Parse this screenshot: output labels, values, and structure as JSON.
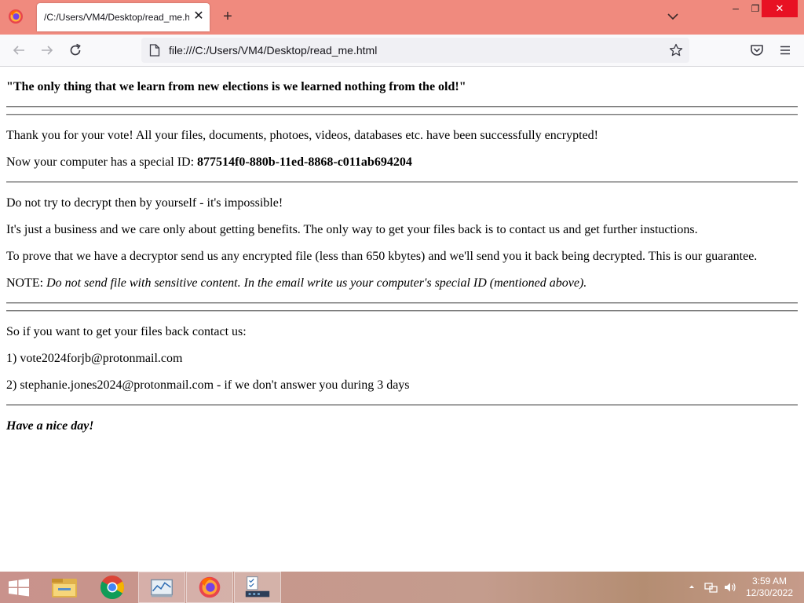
{
  "browser": {
    "tab_title": "/C:/Users/VM4/Desktop/read_me.html",
    "tab_close": "✕",
    "new_tab": "+",
    "url": "file:///C:/Users/VM4/Desktop/read_me.html",
    "window_controls": {
      "minimize": "–",
      "maximize": "❐",
      "close": "✕"
    },
    "accent": "#f08a7e"
  },
  "note": {
    "quote": "\"The only thing that we learn from new elections is we learned nothing from the old!\"",
    "thanks": "Thank you for your vote! All your files, documents, photoes, videos, databases etc. have been successfully encrypted!",
    "id_prefix": "Now your computer has a special ID: ",
    "id_value": "877514f0-880b-11ed-8868-c011ab694204",
    "warn": "Do not try to decrypt then by yourself - it's impossible!",
    "business": "It's just a business and we care only about getting benefits. The only way to get your files back is to contact us and get further instuctions.",
    "prove": "To prove that we have a decryptor send us any encrypted file (less than 650 kbytes) and we'll send you it back being decrypted. This is our guarantee.",
    "note_label": "NOTE: ",
    "note_text": "Do not send file with sensitive content. In the email write us your computer's special ID (mentioned above).",
    "contact_intro": "So if you want to get your files back contact us:",
    "contact1": "1) vote2024forjb@protonmail.com",
    "contact2": "2) stephanie.jones2024@protonmail.com - if we don't answer you during 3 days",
    "goodbye": "Have a nice day!"
  },
  "taskbar": {
    "time": "3:59 AM",
    "date": "12/30/2022",
    "items": [
      "start-icon",
      "file-explorer-icon",
      "chrome-icon",
      "task-manager-icon",
      "firefox-icon",
      "network-app-icon"
    ]
  }
}
